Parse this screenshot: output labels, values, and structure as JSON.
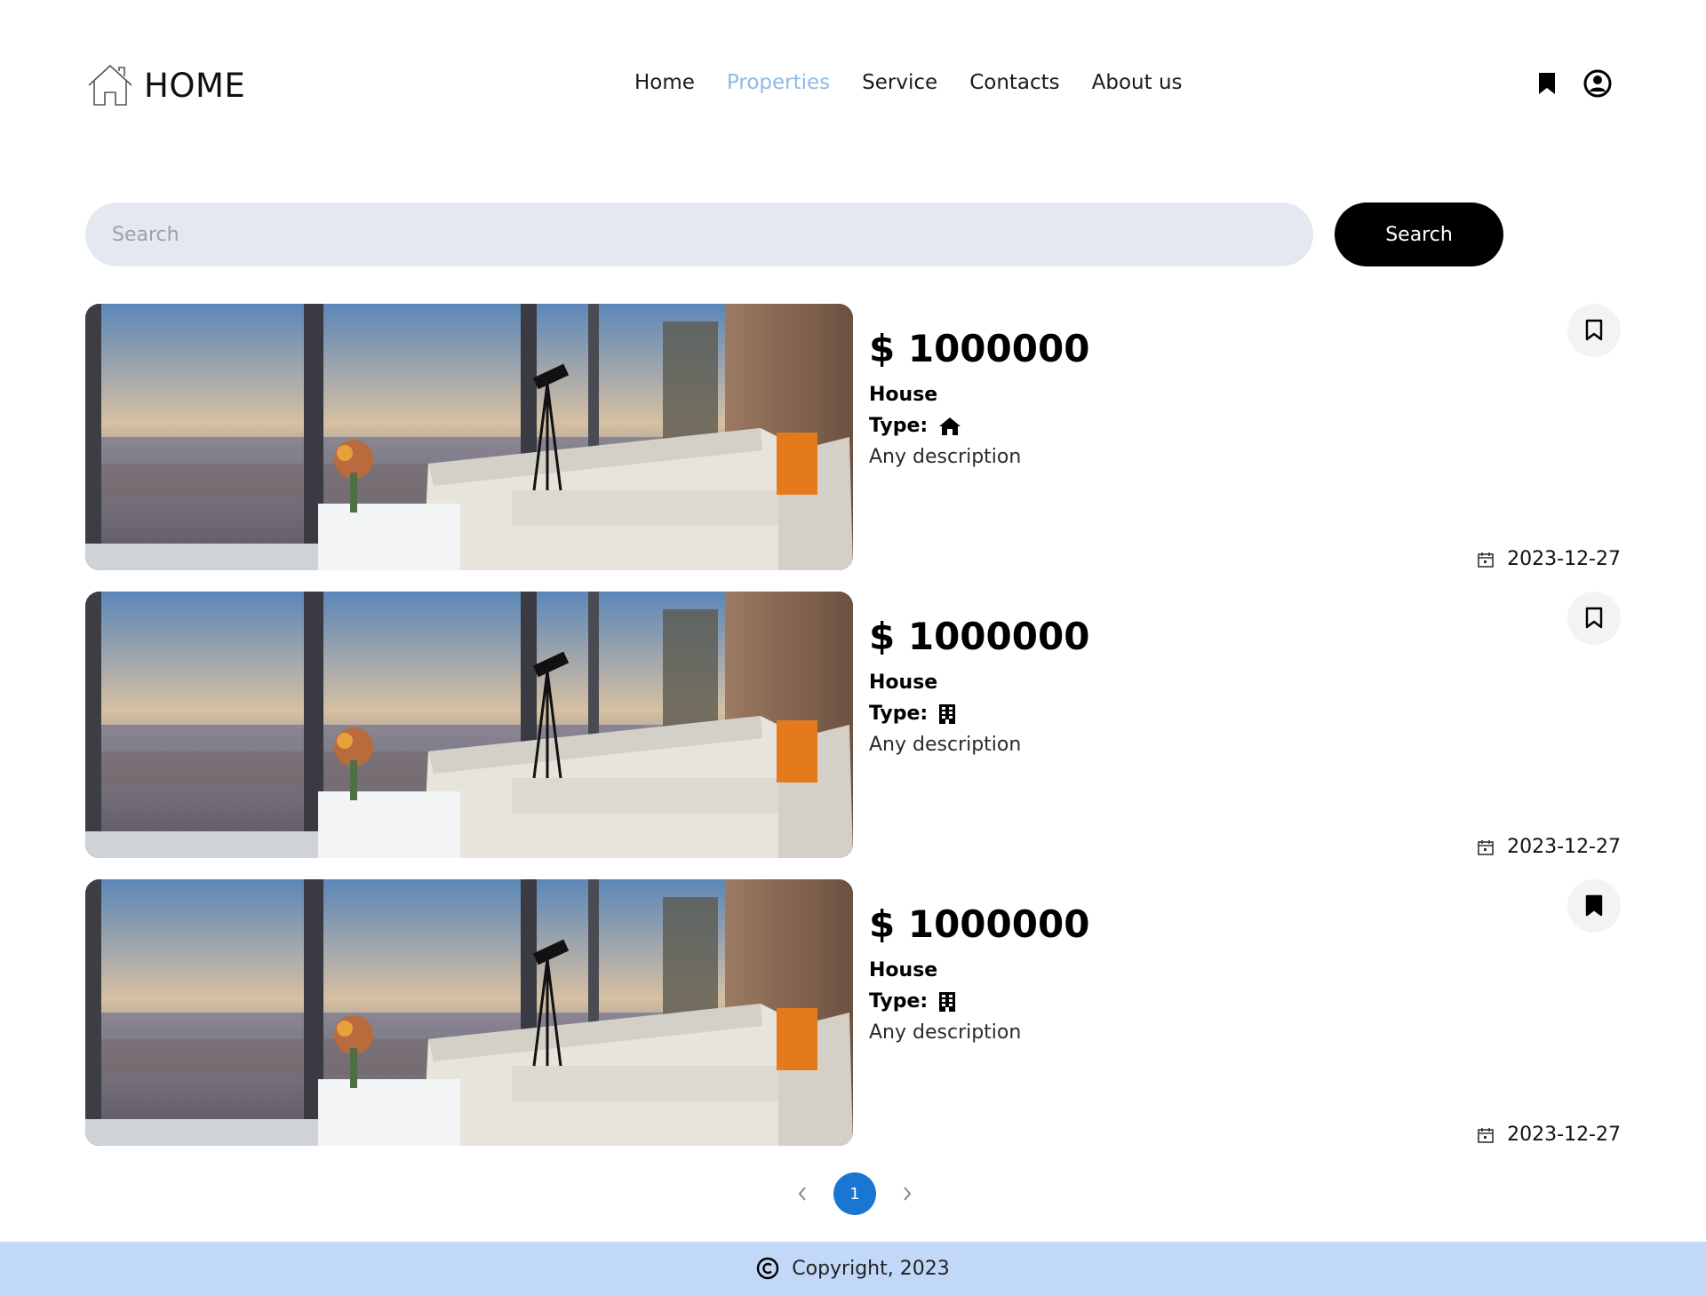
{
  "header": {
    "logo_text": "HOME",
    "nav": [
      {
        "label": "Home",
        "active": false
      },
      {
        "label": "Properties",
        "active": true
      },
      {
        "label": "Service",
        "active": false
      },
      {
        "label": "Contacts",
        "active": false
      },
      {
        "label": "About us",
        "active": false
      }
    ],
    "icons": [
      "bookmark-icon",
      "account-icon"
    ]
  },
  "search": {
    "placeholder": "Search",
    "value": "",
    "button_label": "Search"
  },
  "listings": [
    {
      "price": "$ 1000000",
      "title": "House",
      "type_label": "Type:",
      "type_icon": "house-icon",
      "description": "Any description",
      "date": "2023-12-27",
      "bookmarked": false
    },
    {
      "price": "$ 1000000",
      "title": "House",
      "type_label": "Type:",
      "type_icon": "building-icon",
      "description": "Any description",
      "date": "2023-12-27",
      "bookmarked": false
    },
    {
      "price": "$ 1000000",
      "title": "House",
      "type_label": "Type:",
      "type_icon": "building-icon",
      "description": "Any description",
      "date": "2023-12-27",
      "bookmarked": true
    }
  ],
  "pagination": {
    "current": "1"
  },
  "footer": {
    "copyright": "Copyright, 2023"
  },
  "colors": {
    "active_nav": "#8fb9e6",
    "search_bg": "#e3e8f1",
    "page_active": "#1976d2",
    "footer_bg": "#c2d8f8"
  }
}
